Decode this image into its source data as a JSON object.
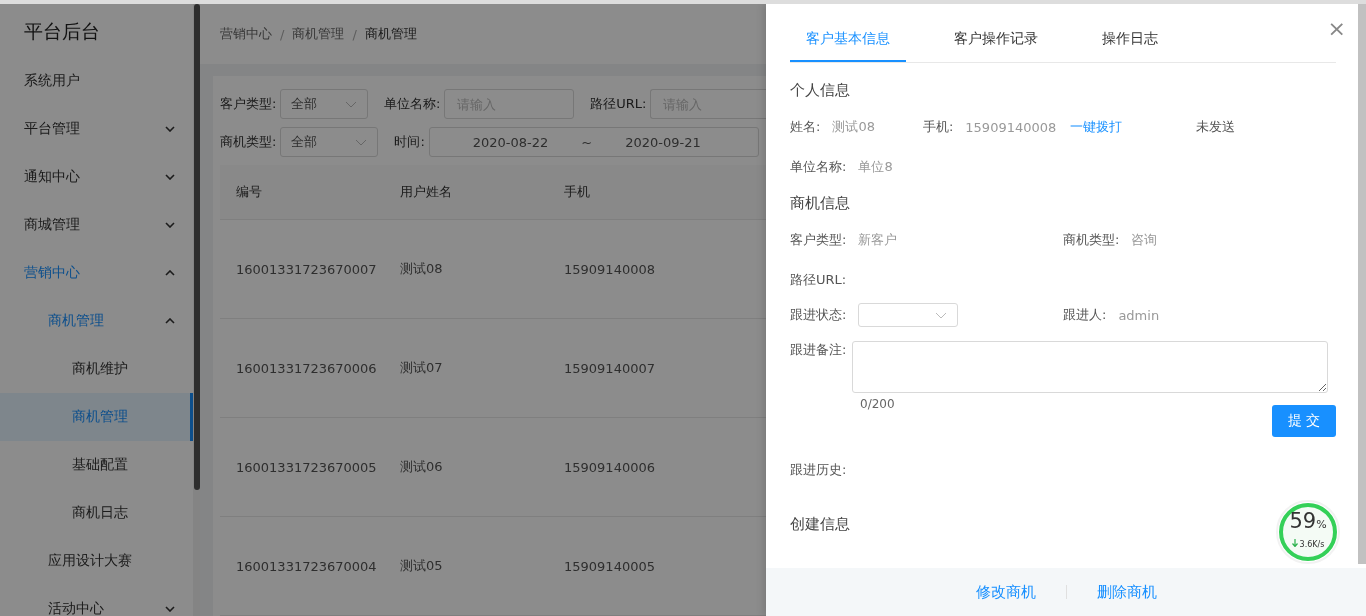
{
  "sidebar": {
    "title": "平台后台",
    "items": [
      {
        "label": "系统用户",
        "selected": false
      },
      {
        "label": "平台管理",
        "selected": false,
        "expanded": false
      },
      {
        "label": "通知中心",
        "selected": false,
        "expanded": false
      },
      {
        "label": "商城管理",
        "selected": false,
        "expanded": false
      },
      {
        "label": "营销中心",
        "selected": false,
        "expanded": true,
        "children": [
          {
            "label": "商机管理",
            "selected": false,
            "expanded": true,
            "children": [
              {
                "label": "商机维护",
                "selected": false
              },
              {
                "label": "商机管理",
                "selected": true
              },
              {
                "label": "基础配置",
                "selected": false
              },
              {
                "label": "商机日志",
                "selected": false
              }
            ]
          },
          {
            "label": "应用设计大赛",
            "selected": false
          },
          {
            "label": "活动中心",
            "selected": false,
            "expanded": false
          }
        ]
      }
    ]
  },
  "breadcrumb": {
    "separator": "/",
    "items": [
      "营销中心",
      "商机管理",
      "商机管理"
    ]
  },
  "filters": [
    [
      {
        "kind": "select",
        "label": "客户类型:",
        "value": "全部"
      },
      {
        "kind": "input",
        "label": "单位名称:",
        "placeholder": "请输入"
      },
      {
        "kind": "input",
        "label": "路径URL:",
        "placeholder": "请输入"
      }
    ],
    [
      {
        "kind": "select",
        "label": "商机类型:",
        "value": "全部"
      },
      {
        "kind": "daterange",
        "label": "时间:",
        "start": "2020-08-22",
        "separator": "~",
        "end": "2020-09-21"
      }
    ]
  ],
  "table": {
    "columns": [
      "编号",
      "用户姓名",
      "手机"
    ],
    "rows": [
      [
        "16001331723670007",
        "测试08",
        "15909140008"
      ],
      [
        "16001331723670006",
        "测试07",
        "15909140007"
      ],
      [
        "16001331723670005",
        "测试06",
        "15909140006"
      ],
      [
        "16001331723670004",
        "测试05",
        "15909140005"
      ]
    ]
  },
  "drawer": {
    "close": "×",
    "tabs": [
      {
        "label": "客户基本信息",
        "selected": true
      },
      {
        "label": "客户操作记录",
        "selected": false
      },
      {
        "label": "操作日志",
        "selected": false
      }
    ],
    "personal": {
      "title": "个人信息",
      "name_label": "姓名:",
      "name": "测试08",
      "phone_label": "手机:",
      "phone": "15909140008",
      "call_link": "一键拨打",
      "send_status": "未发送",
      "company_label": "单位名称:",
      "company": "单位8"
    },
    "opportunity": {
      "title": "商机信息",
      "customer_type_label": "客户类型:",
      "customer_type": "新客户",
      "opportunity_type_label": "商机类型:",
      "opportunity_type": "咨询",
      "url_label": "路径URL:",
      "status_label": "跟进状态:",
      "follower_label": "跟进人:",
      "follower": "admin",
      "note_label": "跟进备注:",
      "note_count": "0/200",
      "submit": "提 交",
      "history_label": "跟进历史:"
    },
    "creation": {
      "title": "创建信息"
    },
    "footer": [
      "修改商机",
      "删除商机"
    ]
  },
  "speed_widget": {
    "percent": "59",
    "unit": "%",
    "speed": "3.6K/s"
  }
}
